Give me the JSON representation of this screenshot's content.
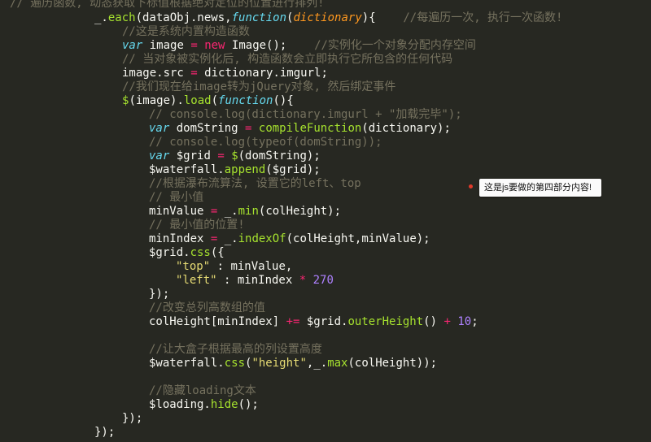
{
  "colors": {
    "background": "#272822",
    "comment": "#75715e",
    "keyword": "#66d9ef",
    "string": "#e6db74",
    "number": "#ae81ff",
    "operator": "#f92672",
    "function": "#a6e22e",
    "parameter": "#fd971f",
    "plain": "#f8f8f2",
    "tooltip_dot": "#e03a2a"
  },
  "tooltip": {
    "text": "这是js要做的第四部分内容!"
  },
  "code_lines": [
    [
      {
        "t": "comment",
        "v": "// 遍历函数, 动态获取下标值根据绝对定位的位置进行排列!"
      }
    ],
    [
      {
        "t": "plain",
        "v": "_."
      },
      {
        "t": "func",
        "v": "each"
      },
      {
        "t": "plain",
        "v": "(dataObj.news,"
      },
      {
        "t": "keyword",
        "v": "function"
      },
      {
        "t": "plain",
        "v": "("
      },
      {
        "t": "param",
        "v": "dictionary"
      },
      {
        "t": "plain",
        "v": "){    "
      },
      {
        "t": "comment",
        "v": "//每遍历一次, 执行一次函数!"
      }
    ],
    [
      {
        "t": "comment",
        "v": "//这是系统内置构造函数"
      }
    ],
    [
      {
        "t": "keyword",
        "v": "var"
      },
      {
        "t": "plain",
        "v": " image "
      },
      {
        "t": "operator",
        "v": "="
      },
      {
        "t": "plain",
        "v": " "
      },
      {
        "t": "new",
        "v": "new"
      },
      {
        "t": "plain",
        "v": " Image();    "
      },
      {
        "t": "comment",
        "v": "//实例化一个对象分配内存空间"
      }
    ],
    [
      {
        "t": "comment",
        "v": "// 当对象被实例化后, 构造函数会立即执行它所包含的任何代码"
      }
    ],
    [
      {
        "t": "plain",
        "v": "image.src "
      },
      {
        "t": "operator",
        "v": "="
      },
      {
        "t": "plain",
        "v": " dictionary.imgurl;"
      }
    ],
    [
      {
        "t": "comment",
        "v": "//我们现在给image转为jQuery对象, 然后绑定事件"
      }
    ],
    [
      {
        "t": "func",
        "v": "$"
      },
      {
        "t": "plain",
        "v": "(image)."
      },
      {
        "t": "func",
        "v": "load"
      },
      {
        "t": "plain",
        "v": "("
      },
      {
        "t": "keyword",
        "v": "function"
      },
      {
        "t": "plain",
        "v": "(){"
      }
    ],
    [
      {
        "t": "comment",
        "v": "// console.log(dictionary.imgurl + \"加载完毕\");"
      }
    ],
    [
      {
        "t": "keyword",
        "v": "var"
      },
      {
        "t": "plain",
        "v": " domString "
      },
      {
        "t": "operator",
        "v": "="
      },
      {
        "t": "plain",
        "v": " "
      },
      {
        "t": "func",
        "v": "compileFunction"
      },
      {
        "t": "plain",
        "v": "(dictionary);"
      }
    ],
    [
      {
        "t": "comment",
        "v": "// console.log(typeof(domString));"
      }
    ],
    [
      {
        "t": "keyword",
        "v": "var"
      },
      {
        "t": "plain",
        "v": " $grid "
      },
      {
        "t": "operator",
        "v": "="
      },
      {
        "t": "plain",
        "v": " "
      },
      {
        "t": "func",
        "v": "$"
      },
      {
        "t": "plain",
        "v": "(domString);"
      }
    ],
    [
      {
        "t": "plain",
        "v": "$waterfall."
      },
      {
        "t": "func",
        "v": "append"
      },
      {
        "t": "plain",
        "v": "($grid);"
      }
    ],
    [
      {
        "t": "comment",
        "v": "//根据瀑布流算法, 设置它的left、top"
      }
    ],
    [
      {
        "t": "comment",
        "v": "// 最小值"
      }
    ],
    [
      {
        "t": "plain",
        "v": "minValue "
      },
      {
        "t": "operator",
        "v": "="
      },
      {
        "t": "plain",
        "v": " _."
      },
      {
        "t": "func",
        "v": "min"
      },
      {
        "t": "plain",
        "v": "(colHeight);"
      }
    ],
    [
      {
        "t": "comment",
        "v": "// 最小值的位置!"
      }
    ],
    [
      {
        "t": "plain",
        "v": "minIndex "
      },
      {
        "t": "operator",
        "v": "="
      },
      {
        "t": "plain",
        "v": " _."
      },
      {
        "t": "func",
        "v": "indexOf"
      },
      {
        "t": "plain",
        "v": "(colHeight,minValue);"
      }
    ],
    [
      {
        "t": "plain",
        "v": "$grid."
      },
      {
        "t": "func",
        "v": "css"
      },
      {
        "t": "plain",
        "v": "({"
      }
    ],
    [
      {
        "t": "string",
        "v": "\"top\""
      },
      {
        "t": "plain",
        "v": " : minValue,"
      }
    ],
    [
      {
        "t": "string",
        "v": "\"left\""
      },
      {
        "t": "plain",
        "v": " : minIndex "
      },
      {
        "t": "operator",
        "v": "*"
      },
      {
        "t": "plain",
        "v": " "
      },
      {
        "t": "number",
        "v": "270"
      }
    ],
    [
      {
        "t": "plain",
        "v": "});"
      }
    ],
    [
      {
        "t": "comment",
        "v": "//改变总列高数组的值"
      }
    ],
    [
      {
        "t": "plain",
        "v": "colHeight[minIndex] "
      },
      {
        "t": "operator",
        "v": "+="
      },
      {
        "t": "plain",
        "v": " $grid."
      },
      {
        "t": "func",
        "v": "outerHeight"
      },
      {
        "t": "plain",
        "v": "() "
      },
      {
        "t": "operator",
        "v": "+"
      },
      {
        "t": "plain",
        "v": " "
      },
      {
        "t": "number",
        "v": "10"
      },
      {
        "t": "plain",
        "v": ";"
      }
    ],
    [],
    [
      {
        "t": "comment",
        "v": "//让大盒子根据最高的列设置高度"
      }
    ],
    [
      {
        "t": "plain",
        "v": "$waterfall."
      },
      {
        "t": "func",
        "v": "css"
      },
      {
        "t": "plain",
        "v": "("
      },
      {
        "t": "string",
        "v": "\"height\""
      },
      {
        "t": "plain",
        "v": ",_."
      },
      {
        "t": "func",
        "v": "max"
      },
      {
        "t": "plain",
        "v": "(colHeight));"
      }
    ],
    [],
    [
      {
        "t": "comment",
        "v": "//隐藏loading文本"
      }
    ],
    [
      {
        "t": "plain",
        "v": "$loading."
      },
      {
        "t": "func",
        "v": "hide"
      },
      {
        "t": "plain",
        "v": "();"
      }
    ],
    [
      {
        "t": "plain",
        "v": "});"
      }
    ],
    [
      {
        "t": "plain",
        "v": "});"
      }
    ]
  ]
}
